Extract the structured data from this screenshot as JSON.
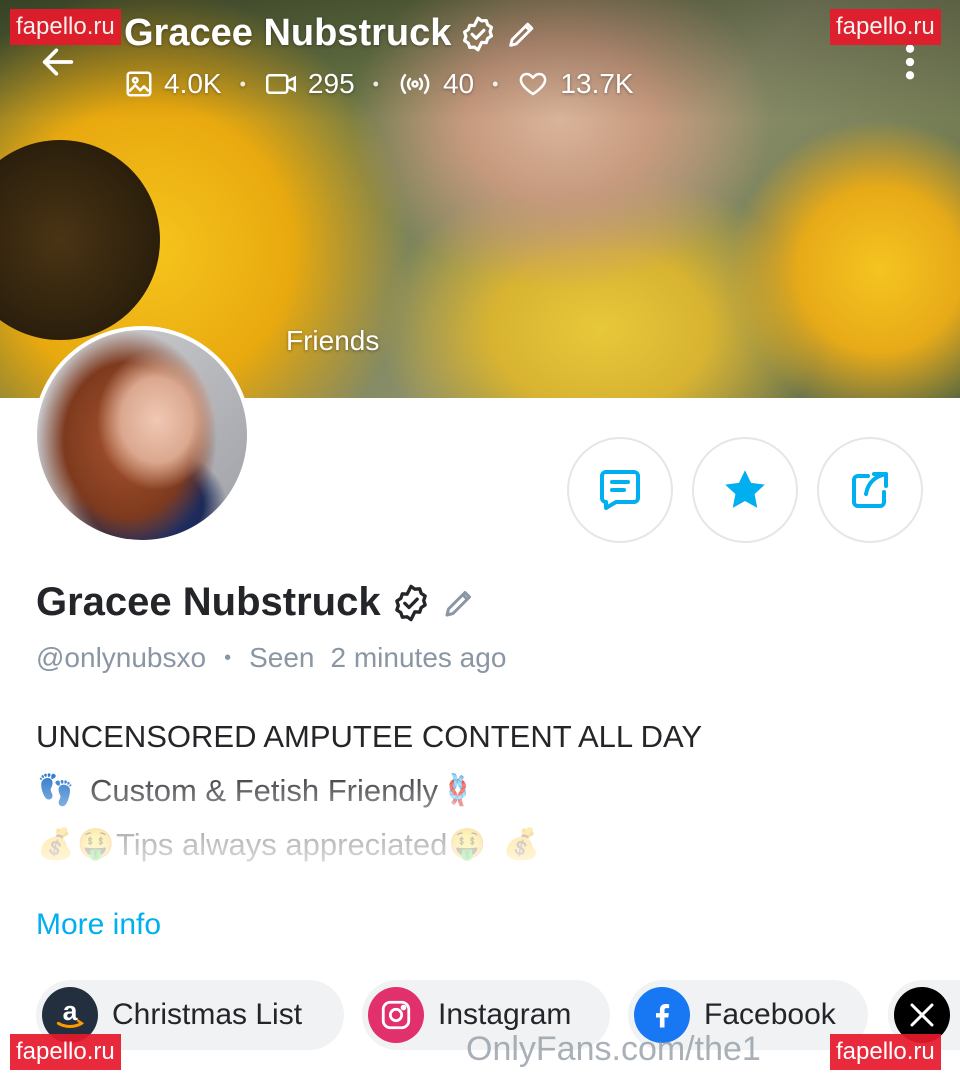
{
  "header": {
    "name": "Gracee Nubstruck",
    "stats": [
      {
        "icon": "image-icon",
        "value": "4.0K"
      },
      {
        "icon": "video-icon",
        "value": "295"
      },
      {
        "icon": "stream-icon",
        "value": "40"
      },
      {
        "icon": "heart-icon",
        "value": "13.7K"
      }
    ],
    "cover_label": "Friends"
  },
  "profile": {
    "name": "Gracee Nubstruck",
    "handle": "@onlynubsxo",
    "seen_label": "Seen",
    "seen_time": "2 minutes ago"
  },
  "bio": {
    "line1": "UNCENSORED AMPUTEE CONTENT ALL DAY",
    "line2_emoji": "👣",
    "line2": "Custom & Fetish Friendly",
    "line2_emoji_end": "🪢",
    "line3_emoji_a": "💰",
    "line3_emoji_b": "🤑",
    "line3": "Tips always appreciated",
    "line3_emoji_c": "🤑",
    "line3_emoji_d": "💰",
    "more_info": "More info"
  },
  "links": [
    {
      "label": "Christmas List",
      "icon": "amazon-icon",
      "color": "#232f3e"
    },
    {
      "label": "Instagram",
      "icon": "instagram-icon",
      "color": "#e1306c"
    },
    {
      "label": "Facebook",
      "icon": "facebook-icon",
      "color": "#1877f2"
    },
    {
      "label": "",
      "icon": "x-icon",
      "color": "#000000"
    }
  ],
  "watermarks": {
    "tl": "fapello.ru",
    "tr": "fapello.ru",
    "bl": "fapello.ru",
    "br": "fapello.ru",
    "footer": "OnlyFans.com/the1"
  },
  "colors": {
    "accent": "#00aff0",
    "muted": "#8a96a3",
    "watermark": "#e8192c"
  }
}
